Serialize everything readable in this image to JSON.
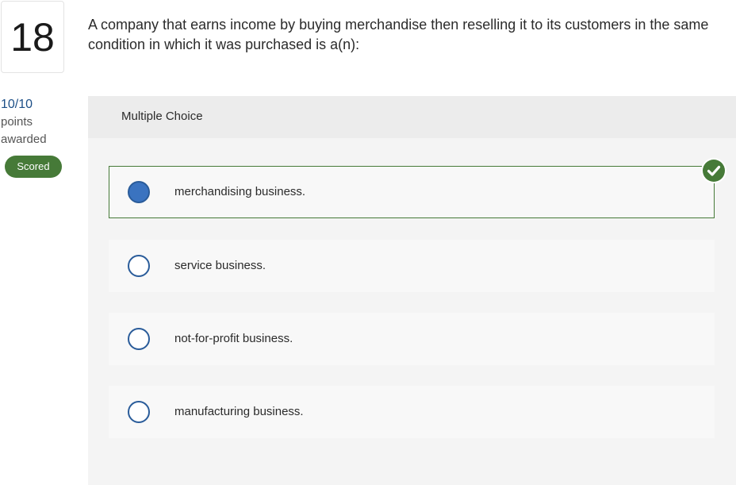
{
  "question": {
    "number": "18",
    "text": "A company that earns income by buying merchandise then reselling it to its customers in the same condition in which it was purchased is a(n):"
  },
  "score": {
    "points": "10/10",
    "line1": "points",
    "line2": "awarded",
    "status_badge": "Scored"
  },
  "panel": {
    "title": "Multiple Choice"
  },
  "options": [
    {
      "label": "merchandising business.",
      "selected": true,
      "correct": true
    },
    {
      "label": "service business.",
      "selected": false
    },
    {
      "label": "not-for-profit business.",
      "selected": false
    },
    {
      "label": "manufacturing business.",
      "selected": false
    }
  ],
  "colors": {
    "accent_green": "#467a38",
    "radio_blue": "#2a5c9a",
    "selected_fill": "#3a73c0",
    "points_blue": "#1c4f87"
  },
  "icons": {
    "correct": "check-circle-icon"
  }
}
